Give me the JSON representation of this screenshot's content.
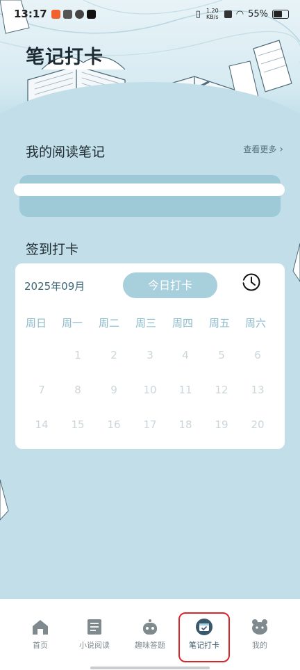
{
  "status_bar": {
    "time": "13:17",
    "network_speed": "1.20 KB/s",
    "battery": "55%"
  },
  "header": {
    "title": "笔记打卡"
  },
  "notes_section": {
    "title": "我的阅读笔记",
    "see_more": "查看更多"
  },
  "checkin_section": {
    "title": "签到打卡"
  },
  "calendar": {
    "month": "2025年09月",
    "checkin_button": "今日打卡",
    "weekdays": [
      "周日",
      "周一",
      "周二",
      "周三",
      "周四",
      "周五",
      "周六"
    ],
    "days": [
      "1",
      "2",
      "3",
      "4",
      "5",
      "6",
      "7",
      "8",
      "9",
      "10",
      "11",
      "12",
      "13",
      "14",
      "15",
      "16",
      "17",
      "18",
      "19",
      "20"
    ]
  },
  "tabs": [
    {
      "label": "首页",
      "icon": "home-icon"
    },
    {
      "label": "小说阅读",
      "icon": "book-icon"
    },
    {
      "label": "趣味答题",
      "icon": "robot-icon"
    },
    {
      "label": "笔记打卡",
      "icon": "calendar-check-icon"
    },
    {
      "label": "我的",
      "icon": "profile-icon"
    }
  ],
  "colors": {
    "page_bg": "#c2dfe9",
    "accent": "#a8cfdc",
    "highlight": "#d8262a"
  }
}
